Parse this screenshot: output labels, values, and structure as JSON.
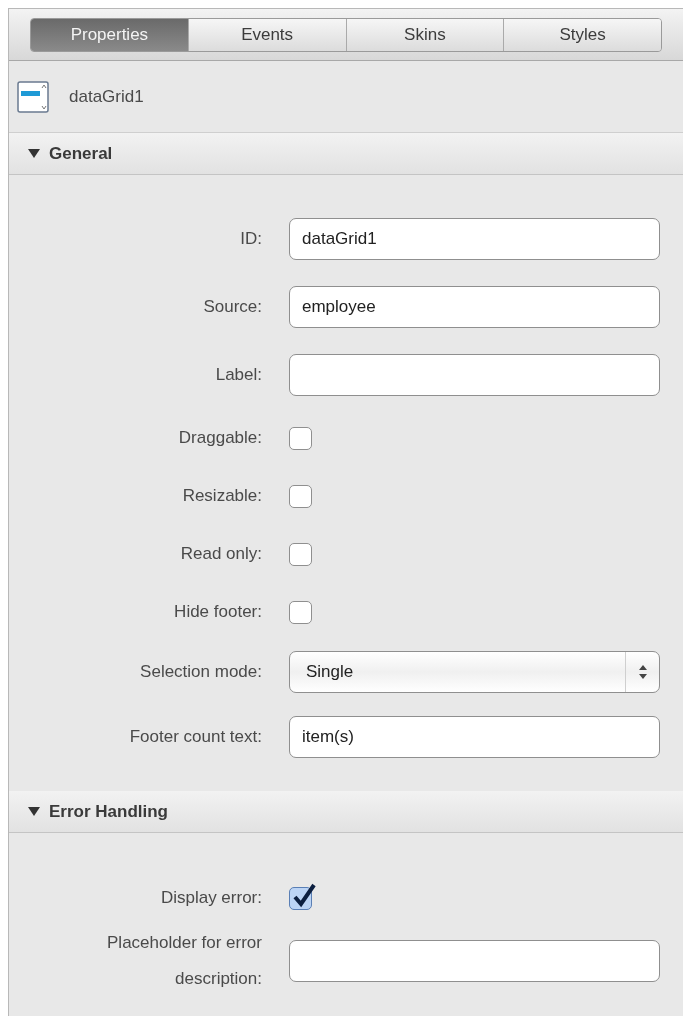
{
  "tabs": [
    {
      "label": "Properties",
      "selected": true
    },
    {
      "label": "Events",
      "selected": false
    },
    {
      "label": "Skins",
      "selected": false
    },
    {
      "label": "Styles",
      "selected": false
    }
  ],
  "component": {
    "name": "dataGrid1"
  },
  "sections": [
    {
      "title": "General",
      "expanded": true,
      "rows": [
        {
          "kind": "text",
          "label": "ID:",
          "value": "dataGrid1"
        },
        {
          "kind": "text",
          "label": "Source:",
          "value": "employee"
        },
        {
          "kind": "text",
          "label": "Label:"
        },
        {
          "kind": "checkbox",
          "label": "Draggable:",
          "checked": false
        },
        {
          "kind": "checkbox",
          "label": "Resizable:",
          "checked": false
        },
        {
          "kind": "checkbox",
          "label": "Read only:",
          "checked": false
        },
        {
          "kind": "checkbox",
          "label": "Hide footer:",
          "checked": false
        },
        {
          "kind": "select",
          "label": "Selection mode:",
          "value": "Single"
        },
        {
          "kind": "text",
          "label": "Footer count text:",
          "value": "item(s)"
        }
      ]
    },
    {
      "title": "Error Handling",
      "expanded": true,
      "rows": [
        {
          "kind": "checkbox",
          "label": "Display error:",
          "checked": true
        },
        {
          "kind": "text",
          "label": "Placeholder for error description:"
        }
      ]
    }
  ]
}
